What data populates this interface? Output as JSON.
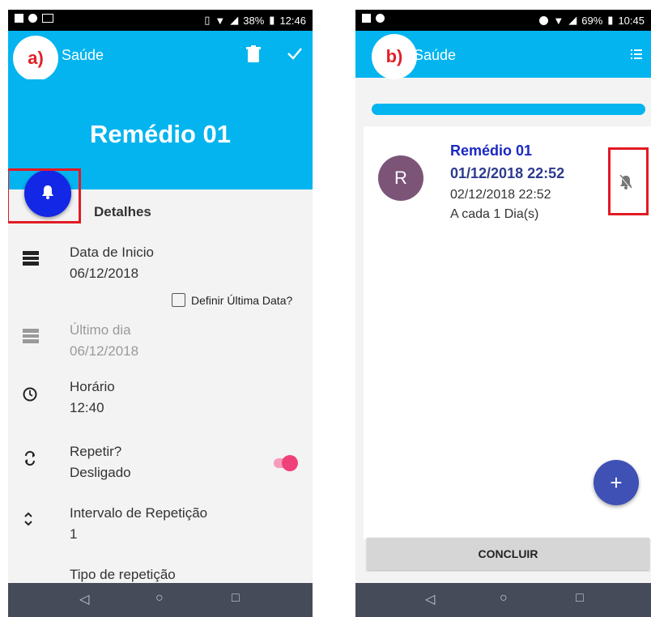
{
  "screenA": {
    "status_battery": "38%",
    "status_time": "12:46",
    "panel_label": "a)",
    "app_title": "Saúde",
    "medicine_name": "Remédio 01",
    "section_title": "Detalhes",
    "start_date_label": "Data de Inicio",
    "start_date_value": "06/12/2018",
    "checkbox_label": "Definir Última Data?",
    "last_day_label": "Último dia",
    "last_day_value": "06/12/2018",
    "time_label": "Horário",
    "time_value": "12:40",
    "repeat_label": "Repetir?",
    "repeat_value": "Desligado",
    "interval_label": "Intervalo de Repetição",
    "interval_value": "1",
    "repeat_type_label": "Tipo de repetição"
  },
  "screenB": {
    "status_battery": "69%",
    "status_time": "10:45",
    "panel_label": "b)",
    "app_title": "Saúde",
    "avatar_letter": "R",
    "item_title": "Remédio 01",
    "item_date_bold": "01/12/2018 22:52",
    "item_date": "02/12/2018 22:52",
    "item_repeat": "A cada 1 Dia(s)",
    "fab_plus": "+",
    "conclude_button": "CONCLUIR"
  },
  "nav": {
    "back": "◁",
    "home": "○",
    "recents": "□"
  },
  "colors": {
    "appbar": "#03b4ef",
    "fab_bell": "#1327e6",
    "highlight": "#e21a23",
    "fab_plus": "#3f51b5",
    "avatar": "#7c5478"
  }
}
